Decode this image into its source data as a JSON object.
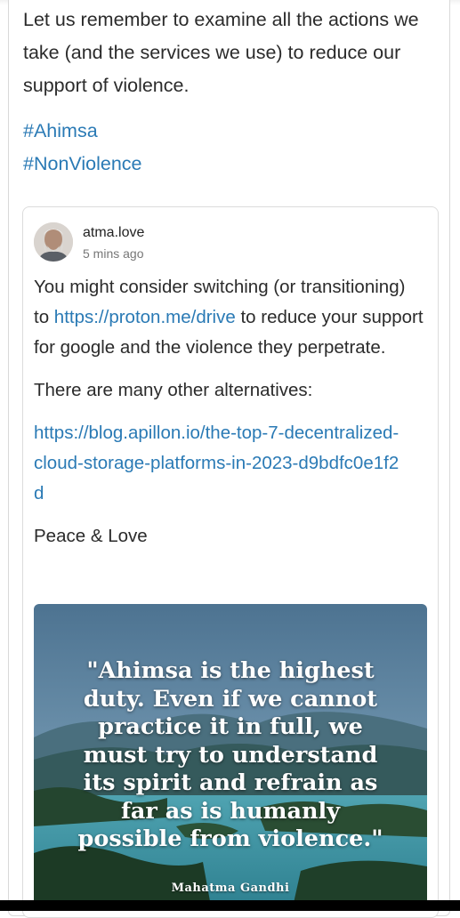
{
  "post": {
    "text": "Let us remember to examine all the actions we take (and the services we use) to reduce our support of violence.",
    "hashtags": [
      "#Ahimsa",
      "#NonViolence"
    ]
  },
  "reply": {
    "author": "atma.love",
    "time": "5 mins ago",
    "para1_before": "You might consider switching (or transitioning) to ",
    "para1_link": "https://proton.me/drive",
    "para1_after": " to reduce your support for google and the violence they perpetrate.",
    "para2": "There are many other alternatives:",
    "link2": "https://blog.apillon.io/the-top-7-decentralized-cloud-storage-platforms-in-2023-d9bdfc0e1f2d",
    "para3": "Peace & Love"
  },
  "image": {
    "quote": "\"Ahimsa is the highest\nduty. Even if we cannot\npractice it in full, we\nmust try to understand\nits spirit and refrain as\nfar as is humanly\npossible from violence.\"",
    "attribution": "Mahatma Gandhi",
    "colors": {
      "sky": "#5b86a8",
      "water": "#3f97a6",
      "forest": "#1f3d2a"
    }
  }
}
